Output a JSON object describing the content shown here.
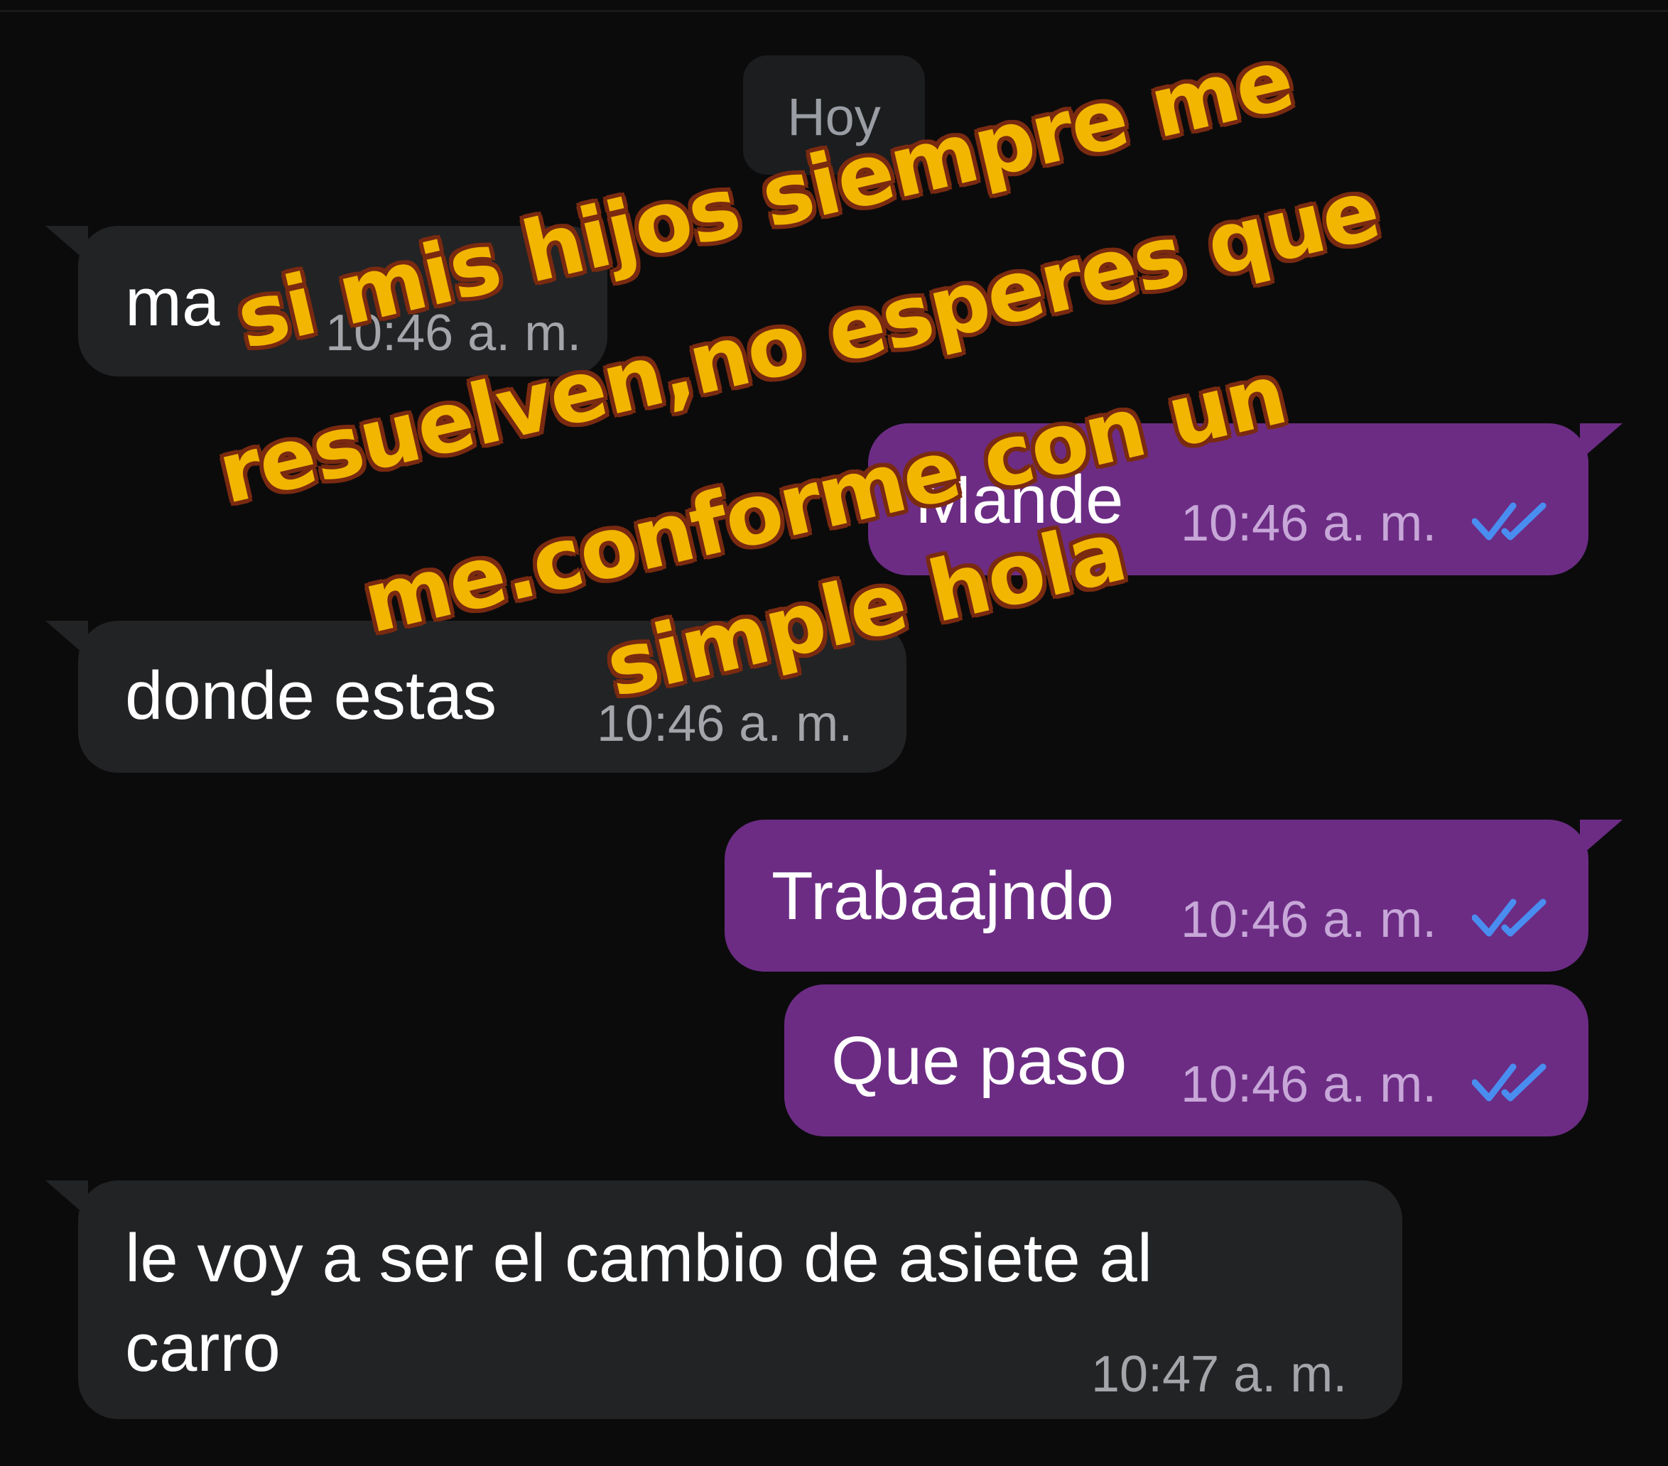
{
  "chat": {
    "date_divider": "Hoy",
    "messages": [
      {
        "direction": "incoming",
        "text": "ma",
        "time": "10:46 a. m."
      },
      {
        "direction": "outgoing",
        "text": "Mande",
        "time": "10:46 a. m.",
        "status": "read",
        "status_icon": "double-check-icon"
      },
      {
        "direction": "incoming",
        "text": "donde estas",
        "time": "10:46 a. m."
      },
      {
        "direction": "outgoing",
        "text": "Trabaajndo",
        "time": "10:46 a. m.",
        "status": "read",
        "status_icon": "double-check-icon"
      },
      {
        "direction": "outgoing",
        "text": "Que paso",
        "time": "10:46 a. m.",
        "status": "read",
        "status_icon": "double-check-icon"
      },
      {
        "direction": "incoming",
        "text_line1": "le voy a ser el cambio de asiete al",
        "text_line2": "carro",
        "time": "10:47 a. m."
      }
    ]
  },
  "overlay_caption": {
    "lines": [
      "si mis hijos siempre me",
      "resuelven,no esperes que",
      "me.conforme con un",
      "simple hola"
    ]
  },
  "colors": {
    "background": "#0b0b0c",
    "incoming_bubble": "#222325",
    "outgoing_bubble": "#6c2c84",
    "read_check": "#4a8df0",
    "caption_fill": "#f2b600",
    "caption_outline": "#7a2a10"
  }
}
